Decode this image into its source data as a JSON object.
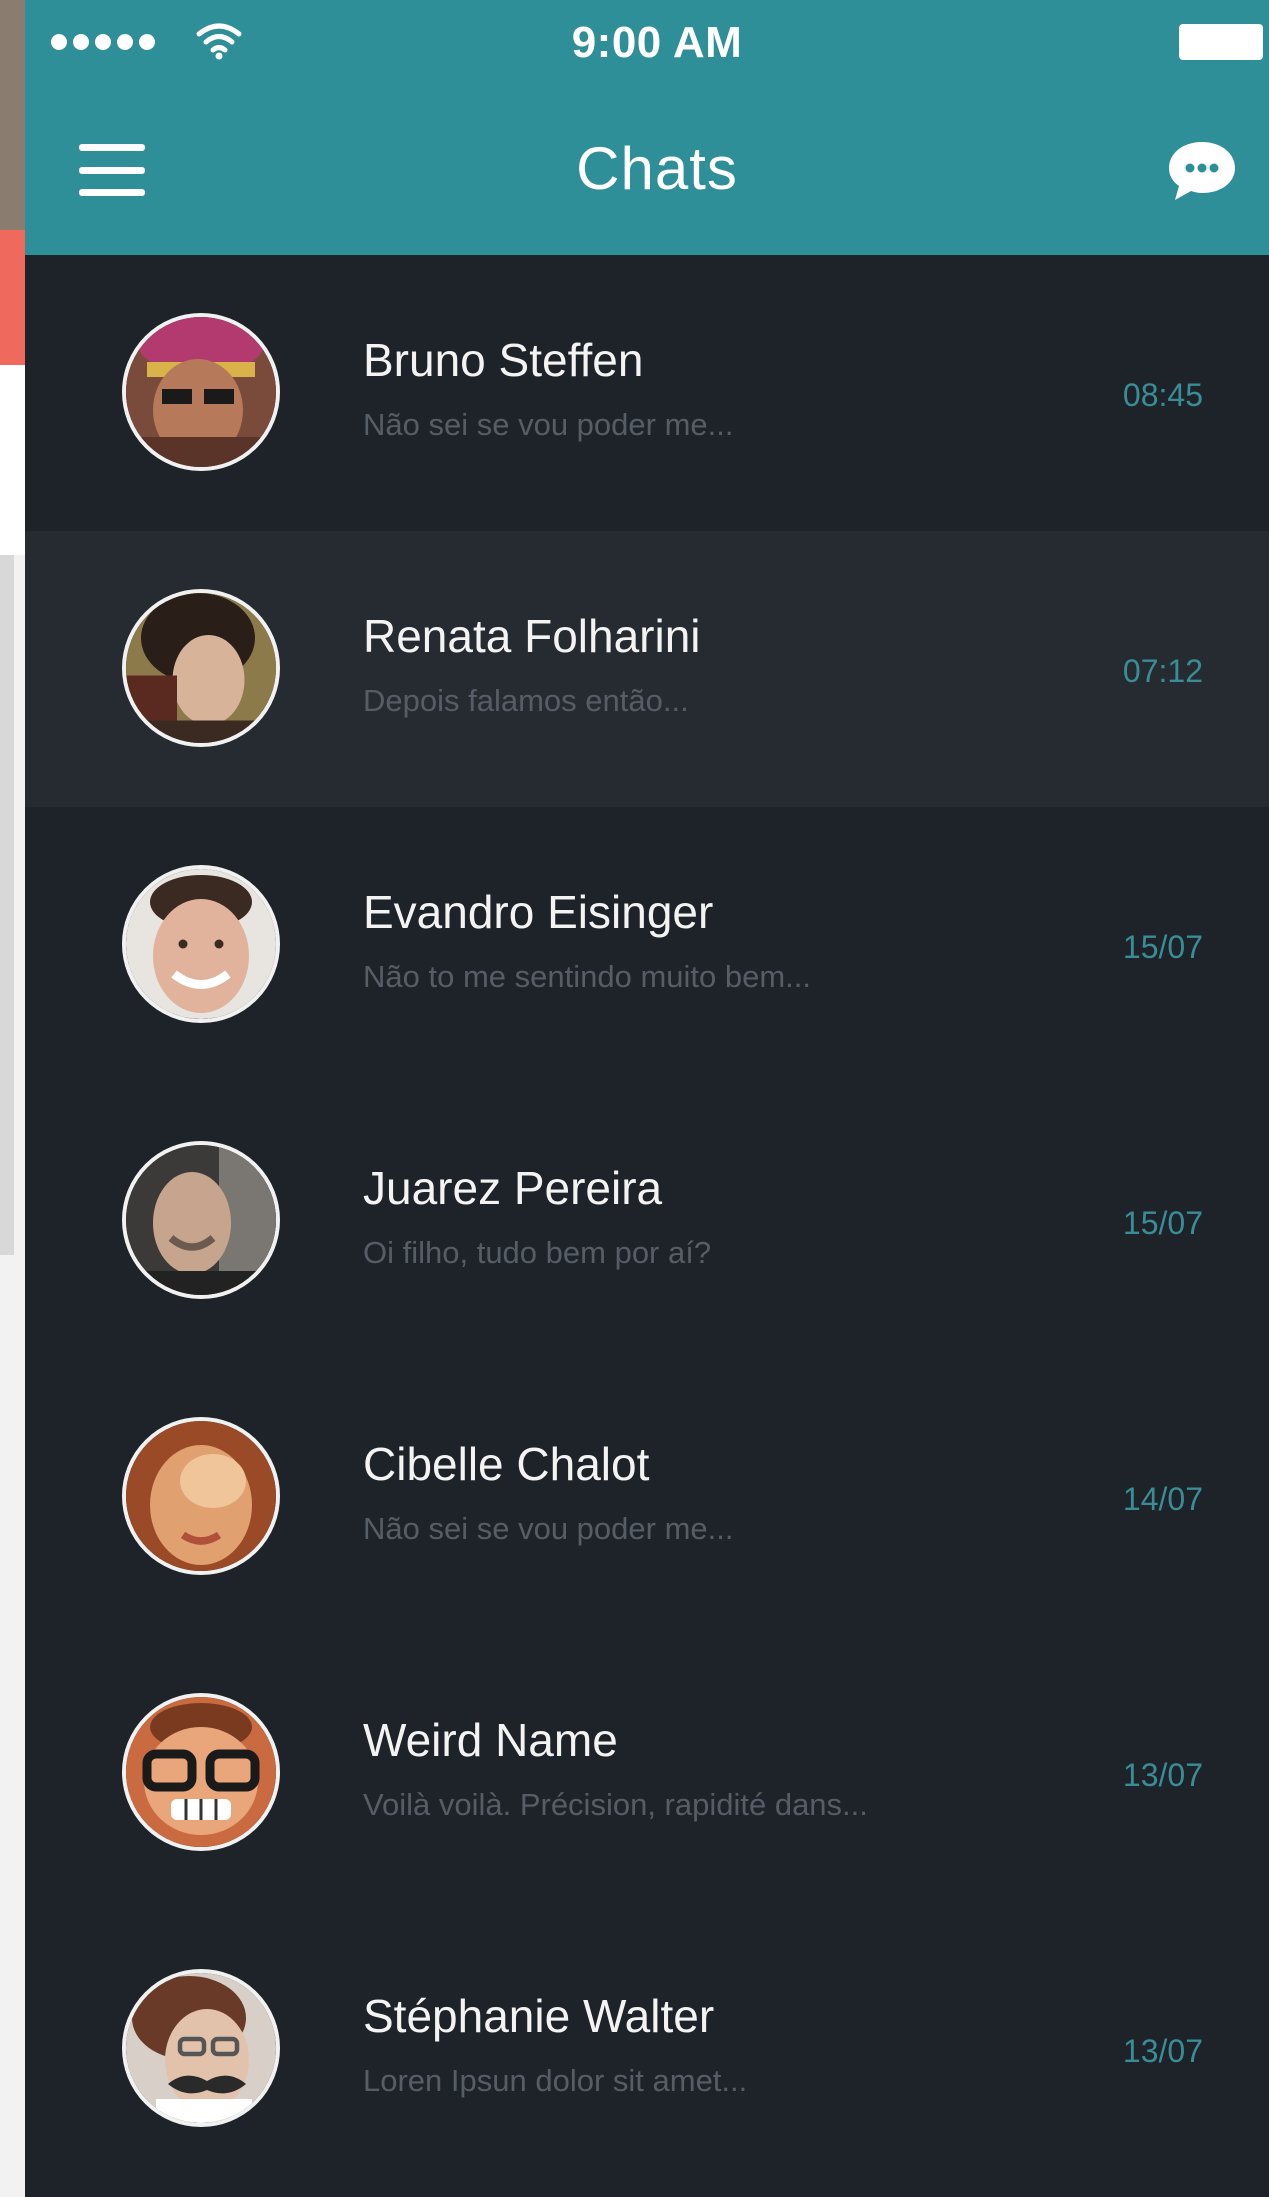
{
  "status_bar": {
    "time": "9:00 AM"
  },
  "header": {
    "title": "Chats",
    "menu_icon": "hamburger-menu-icon",
    "compose_icon": "chat-bubble-icon"
  },
  "colors": {
    "header_bg": "#2e8f99",
    "list_bg": "#1e2329",
    "highlight_bg": "#262b31",
    "time_color": "#3a8d96"
  },
  "chats": [
    {
      "name": "Bruno Steffen",
      "preview": "Não sei se vou poder me...",
      "time": "08:45"
    },
    {
      "name": "Renata Folharini",
      "preview": "Depois falamos então...",
      "time": "07:12"
    },
    {
      "name": "Evandro Eisinger",
      "preview": "Não to me sentindo muito bem...",
      "time": "15/07"
    },
    {
      "name": "Juarez Pereira",
      "preview": "Oi filho, tudo bem por aí?",
      "time": "15/07"
    },
    {
      "name": "Cibelle Chalot",
      "preview": "Não sei se vou poder me...",
      "time": "14/07"
    },
    {
      "name": "Weird Name",
      "preview": "Voilà voilà. Précision, rapidité dans...",
      "time": "13/07"
    },
    {
      "name": "Stéphanie Walter",
      "preview": "Loren Ipsun dolor sit amet...",
      "time": "13/07"
    }
  ]
}
